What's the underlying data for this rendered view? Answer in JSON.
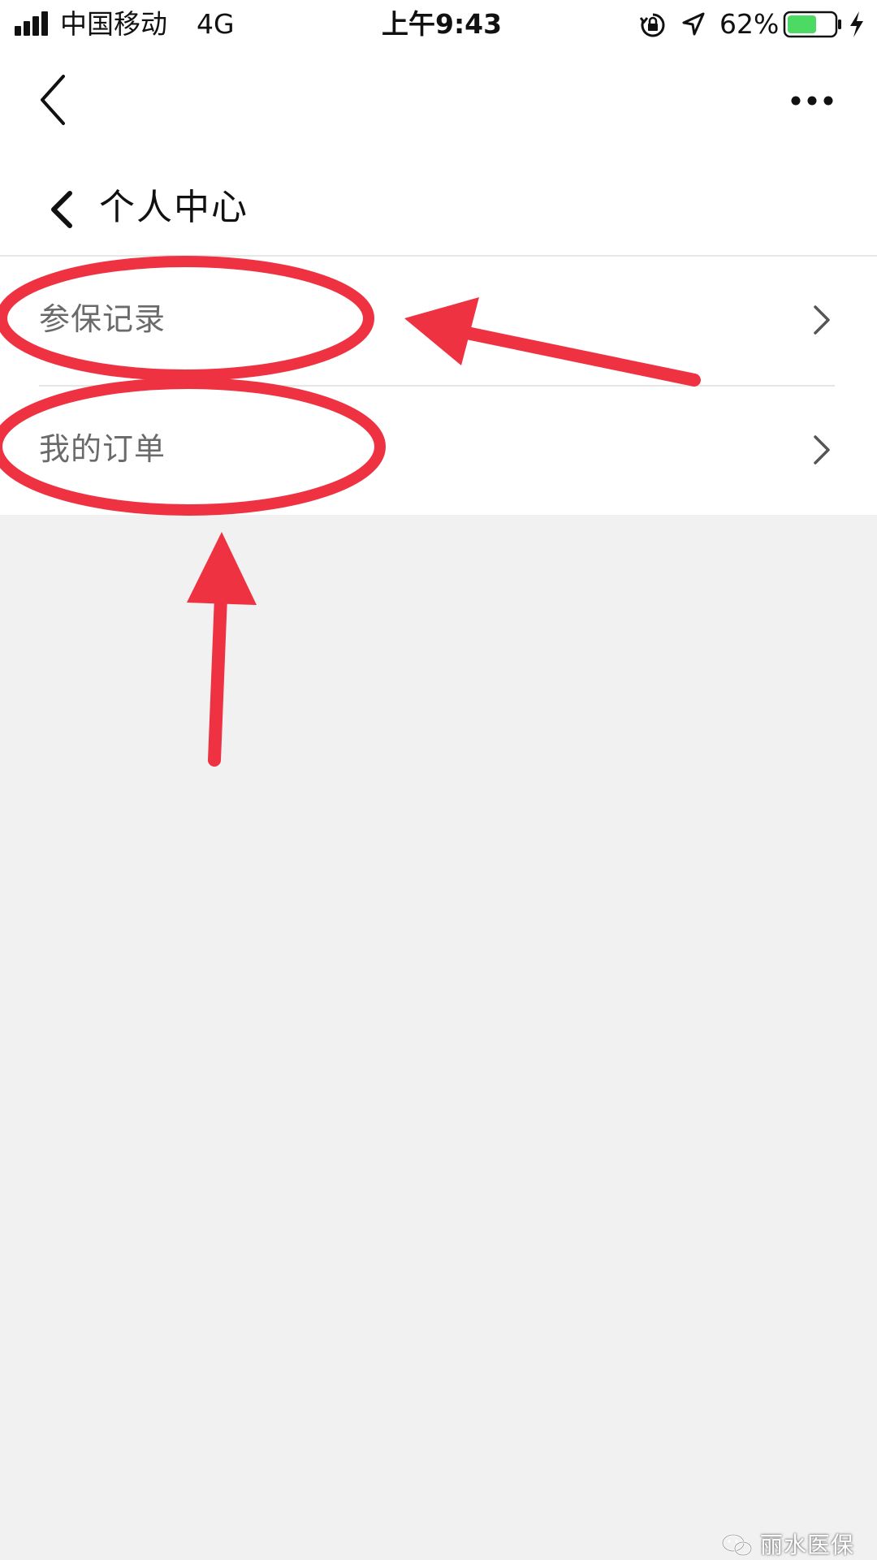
{
  "status_bar": {
    "carrier": "中国移动",
    "network": "4G",
    "time": "上午9:43",
    "battery_percent": "62%",
    "battery_level": 0.62,
    "battery_color": "#4cd964",
    "icons": [
      "signal-icon",
      "orientation-lock-icon",
      "location-icon",
      "battery-icon",
      "charging-icon"
    ]
  },
  "nav_bar": {
    "back_icon": "chevron-left-icon",
    "more_icon": "more-dots-icon"
  },
  "page": {
    "title": "个人中心",
    "back_icon": "chevron-left-icon"
  },
  "menu": {
    "items": [
      {
        "label": "参保记录",
        "icon": "chevron-right-icon"
      },
      {
        "label": "我的订单",
        "icon": "chevron-right-icon"
      }
    ]
  },
  "annotation": {
    "color": "#ee3242"
  },
  "watermark": {
    "icon": "wechat-icon",
    "text": "丽水医保"
  },
  "colors": {
    "background": "#f1f1f1",
    "surface": "#ffffff",
    "menu_text": "#6a6a6a",
    "accent_annotation": "#ee3242"
  }
}
